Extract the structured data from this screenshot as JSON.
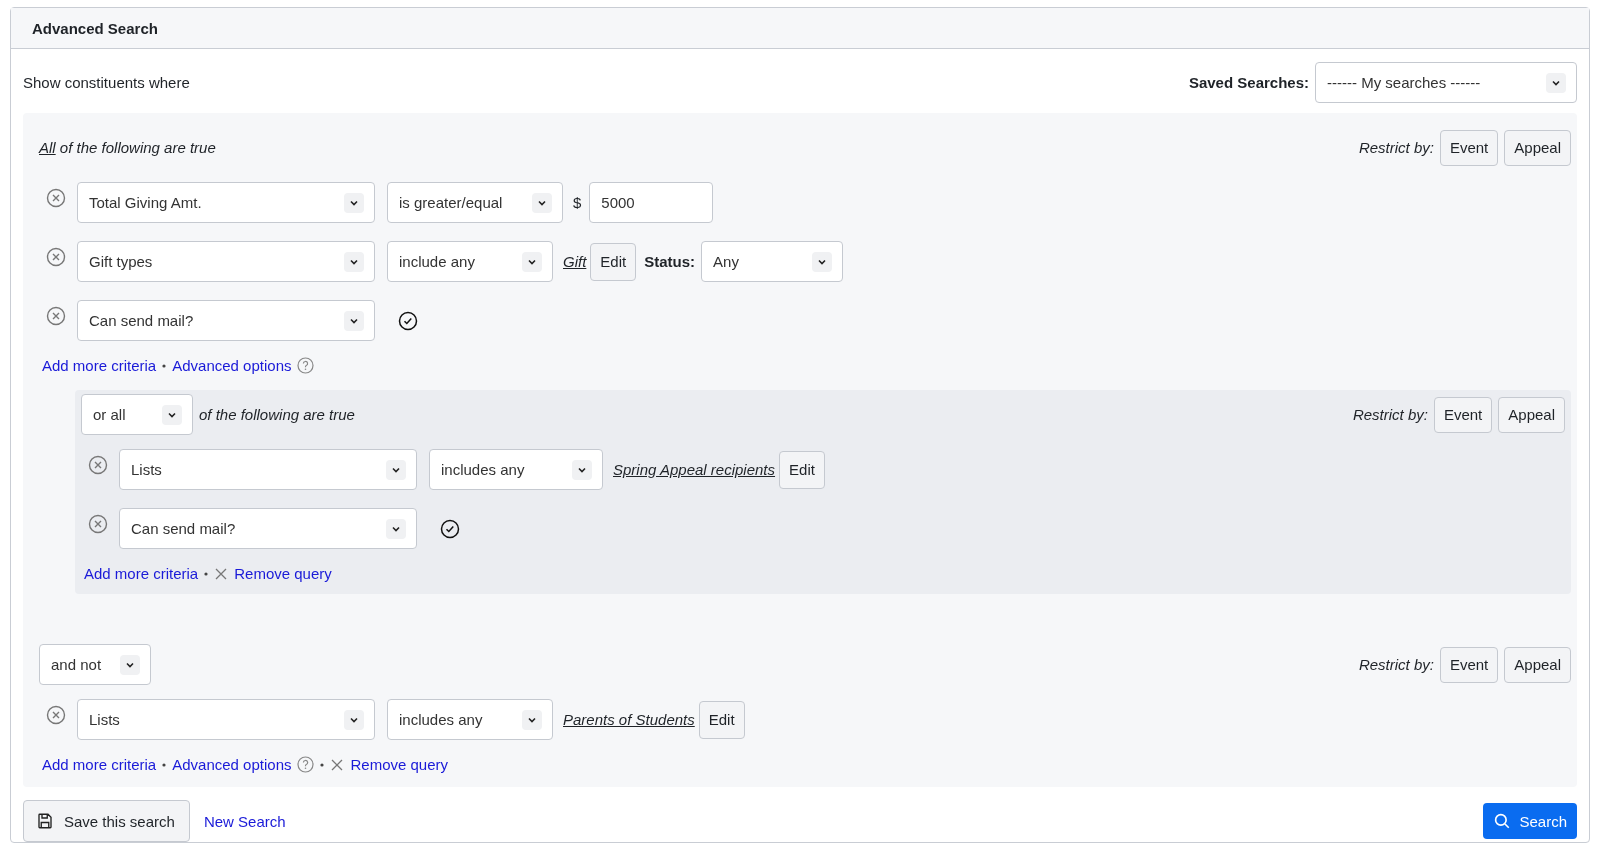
{
  "window": {
    "title": "Advanced Search"
  },
  "intro": "Show constituents where",
  "saved_searches": {
    "label": "Saved Searches:",
    "value": "------ My searches ------"
  },
  "groups": [
    {
      "combinator": {
        "kind": "text",
        "link": "All",
        "text": "of the following are true"
      },
      "restrict": {
        "label": "Restrict by:",
        "buttons": [
          "Event",
          "Appeal"
        ]
      },
      "criteria": [
        {
          "field": "Total Giving Amt.",
          "operator": "is greater/equal",
          "extras": [
            {
              "kind": "currency",
              "text": "$"
            },
            {
              "kind": "input",
              "value": "5000"
            }
          ]
        },
        {
          "field": "Gift types",
          "operator": "include any",
          "extras": [
            {
              "kind": "link",
              "text": "Gift"
            },
            {
              "kind": "button",
              "text": "Edit"
            },
            {
              "kind": "label",
              "text": "Status:"
            },
            {
              "kind": "select",
              "value": "Any"
            }
          ]
        },
        {
          "field": "Can send mail?",
          "extras": [
            {
              "kind": "check"
            }
          ]
        }
      ],
      "actions": [
        {
          "kind": "link",
          "text": "Add more criteria"
        },
        {
          "kind": "link",
          "text": "Advanced options",
          "help": true
        }
      ],
      "subgroups": [
        {
          "combinator": {
            "kind": "select",
            "value": "or all",
            "text": "of the following are true"
          },
          "restrict": {
            "label": "Restrict by:",
            "buttons": [
              "Event",
              "Appeal"
            ]
          },
          "criteria": [
            {
              "field": "Lists",
              "operator": "includes any",
              "extras": [
                {
                  "kind": "link",
                  "text": "Spring Appeal recipients"
                },
                {
                  "kind": "button",
                  "text": "Edit"
                }
              ]
            },
            {
              "field": "Can send mail?",
              "extras": [
                {
                  "kind": "check"
                }
              ]
            }
          ],
          "actions": [
            {
              "kind": "link",
              "text": "Add more criteria"
            },
            {
              "kind": "remove",
              "text": "Remove query"
            }
          ]
        }
      ]
    },
    {
      "combinator": {
        "kind": "select",
        "value": "and not"
      },
      "restrict": {
        "label": "Restrict by:",
        "buttons": [
          "Event",
          "Appeal"
        ]
      },
      "criteria": [
        {
          "field": "Lists",
          "operator": "includes any",
          "extras": [
            {
              "kind": "link",
              "text": "Parents of Students"
            },
            {
              "kind": "button",
              "text": "Edit"
            }
          ]
        }
      ],
      "actions": [
        {
          "kind": "link",
          "text": "Add more criteria"
        },
        {
          "kind": "link",
          "text": "Advanced options",
          "help": true
        },
        {
          "kind": "remove",
          "text": "Remove query"
        }
      ]
    }
  ],
  "footer": {
    "save": "Save this search",
    "new": "New Search",
    "search": "Search"
  }
}
